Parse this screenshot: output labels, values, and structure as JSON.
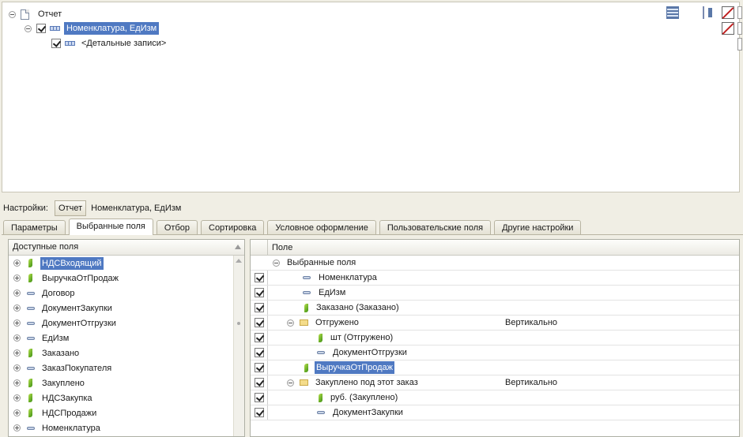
{
  "structure": {
    "root": "Отчет",
    "group": "Номенклатура, ЕдИзм",
    "details": "<Детальные записи>"
  },
  "settings": {
    "caption": "Настройки:",
    "report_button": "Отчет",
    "current": "Номенклатура, ЕдИзм"
  },
  "tabs": [
    {
      "label": "Параметры"
    },
    {
      "label": "Выбранные поля"
    },
    {
      "label": "Отбор"
    },
    {
      "label": "Сортировка"
    },
    {
      "label": "Условное оформление"
    },
    {
      "label": "Пользовательские поля"
    },
    {
      "label": "Другие настройки"
    }
  ],
  "available": {
    "header": "Доступные поля",
    "items": [
      {
        "label": "НДСВходящий",
        "icon": "resource-icon",
        "selected": true
      },
      {
        "label": "ВыручкаОтПродаж",
        "icon": "resource-icon"
      },
      {
        "label": "Договор",
        "icon": "attribute-icon"
      },
      {
        "label": "ДокументЗакупки",
        "icon": "attribute-icon"
      },
      {
        "label": "ДокументОтгрузки",
        "icon": "attribute-icon"
      },
      {
        "label": "ЕдИзм",
        "icon": "attribute-icon"
      },
      {
        "label": "Заказано",
        "icon": "resource-icon"
      },
      {
        "label": "ЗаказПокупателя",
        "icon": "attribute-icon"
      },
      {
        "label": "Закуплено",
        "icon": "resource-icon"
      },
      {
        "label": "НДСЗакупка",
        "icon": "resource-icon"
      },
      {
        "label": "НДСПродажи",
        "icon": "resource-icon"
      },
      {
        "label": "Номенклатура",
        "icon": "attribute-icon"
      }
    ]
  },
  "selected_fields": {
    "header": "Поле",
    "root": "Выбранные поля",
    "rows": [
      {
        "label": "Номенклатура",
        "icon": "attribute-icon",
        "indent": 1,
        "placement": ""
      },
      {
        "label": "ЕдИзм",
        "icon": "attribute-icon",
        "indent": 1,
        "placement": ""
      },
      {
        "label": "Заказано (Заказано)",
        "icon": "resource-icon",
        "indent": 1,
        "placement": ""
      },
      {
        "label": "Отгружено",
        "icon": "folder-icon",
        "indent": 0,
        "placement": "Вертикально",
        "group": true
      },
      {
        "label": "шт (Отгружено)",
        "icon": "resource-icon",
        "indent": 2,
        "placement": ""
      },
      {
        "label": "ДокументОтгрузки",
        "icon": "attribute-icon",
        "indent": 2,
        "placement": ""
      },
      {
        "label": "ВыручкаОтПродаж",
        "icon": "resource-icon",
        "indent": 1,
        "placement": "",
        "selected": true
      },
      {
        "label": "Закуплено под этот заказ",
        "icon": "folder-icon",
        "indent": 0,
        "placement": "Вертикально",
        "group": true
      },
      {
        "label": "руб. (Закуплено)",
        "icon": "resource-icon",
        "indent": 2,
        "placement": ""
      },
      {
        "label": "ДокументЗакупки",
        "icon": "attribute-icon",
        "indent": 2,
        "placement": ""
      }
    ]
  }
}
